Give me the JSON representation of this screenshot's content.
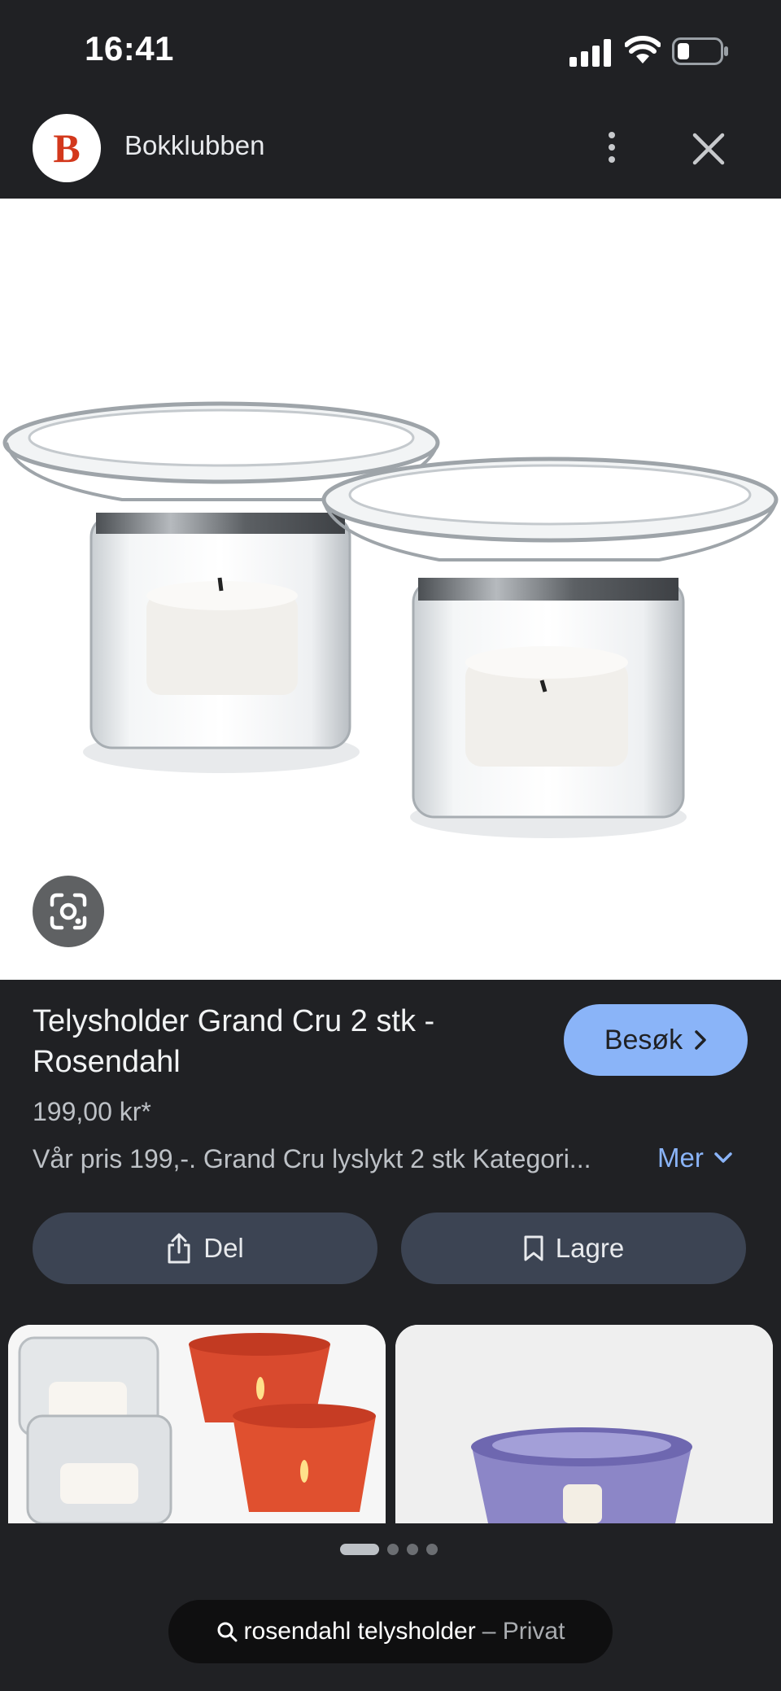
{
  "status_bar": {
    "time": "16:41",
    "battery_icon": "battery-low-icon",
    "wifi_icon": "wifi-icon",
    "signal_icon": "cellular-signal-icon"
  },
  "header": {
    "logo_text": "B",
    "site_name": "Bokklubben"
  },
  "product": {
    "title": "Telysholder Grand Cru 2 stk - Rosendahl",
    "price": "199,00 kr*",
    "description": "Vår pris 199,-. Grand Cru lyslykt 2 stk Kategori...",
    "more_label": "Mer",
    "visit_label": "Besøk"
  },
  "actions": {
    "share_label": "Del",
    "save_label": "Lagre"
  },
  "carousel": {
    "pages": 4,
    "active_index": 0
  },
  "search": {
    "query": "rosendahl telysholder",
    "mode": "– Privat"
  },
  "colors": {
    "background": "#202124",
    "accent": "#8ab4f8",
    "button": "#3c4453",
    "logo": "#d3381c"
  }
}
